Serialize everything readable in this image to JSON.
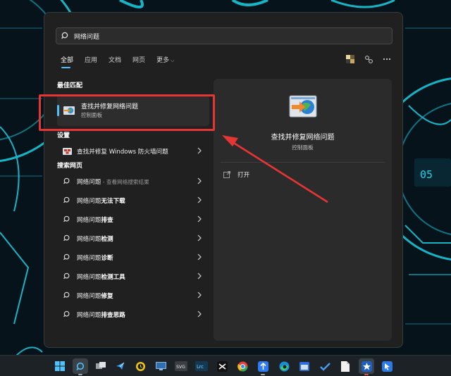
{
  "search": {
    "query": "网络问题"
  },
  "tabs": [
    {
      "label": "全部",
      "active": true
    },
    {
      "label": "应用",
      "active": false
    },
    {
      "label": "文档",
      "active": false
    },
    {
      "label": "网页",
      "active": false
    },
    {
      "label": "更多",
      "active": false
    }
  ],
  "top_icons": [
    "mosaic-tile-icon",
    "account-link-icon",
    "more-dots-icon"
  ],
  "best_match": {
    "section_title": "最佳匹配",
    "title": "查找并修复网络问题",
    "subtitle": "控制面板"
  },
  "settings": {
    "section_title": "设置",
    "items": [
      {
        "label": "查找并修复 Windows 防火墙问题"
      }
    ]
  },
  "web_search": {
    "section_title": "搜索网页",
    "items": [
      {
        "prefix": "网络问题",
        "bold": "",
        "suffix": " - 查看网络搜索结果"
      },
      {
        "prefix": "网络问题",
        "bold": "无法下载",
        "suffix": ""
      },
      {
        "prefix": "网络问题",
        "bold": "排查",
        "suffix": ""
      },
      {
        "prefix": "网络问题",
        "bold": "检测",
        "suffix": ""
      },
      {
        "prefix": "网络问题",
        "bold": "诊断",
        "suffix": ""
      },
      {
        "prefix": "网络问题",
        "bold": "检测工具",
        "suffix": ""
      },
      {
        "prefix": "网络问题",
        "bold": "修复",
        "suffix": ""
      },
      {
        "prefix": "网络问题",
        "bold": "排查思路",
        "suffix": ""
      }
    ]
  },
  "preview": {
    "title": "查找并修复网络问题",
    "subtitle": "控制面板",
    "action_open": "打开"
  },
  "wallpaper": {
    "badge_text": "05"
  },
  "taskbar": {
    "svg_label": "SVG",
    "lrc_label": "Lrc"
  },
  "colors": {
    "accent": "#4cc2ff",
    "annotation_red": "#e63535",
    "panel_bg": "#202020",
    "preview_bg": "#2b2b2b"
  }
}
